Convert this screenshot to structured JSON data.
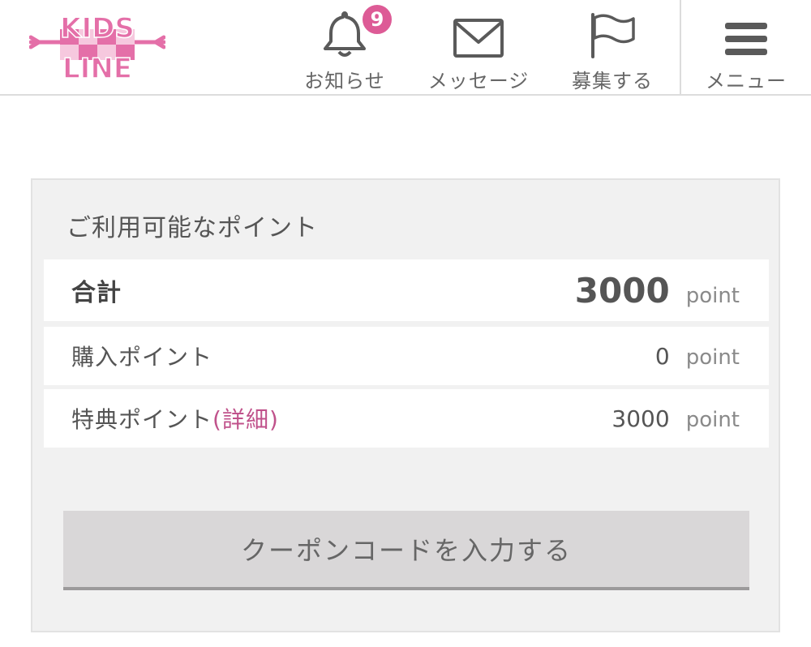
{
  "brand": {
    "logo_line1": "KIDS",
    "logo_line2": "LINE",
    "logo_color": "#e46fa8"
  },
  "nav": {
    "notice_label": "お知らせ",
    "notice_badge": "9",
    "notice_icon": "bell-icon",
    "message_label": "メッセージ",
    "message_icon": "envelope-icon",
    "recruit_label": "募集する",
    "recruit_icon": "flag-icon",
    "menu_label": "メニュー",
    "menu_icon": "hamburger-icon"
  },
  "points": {
    "title": "ご利用可能なポイント",
    "total_label": "合計",
    "total_value": "3000",
    "purchase_label": "購入ポイント",
    "purchase_value": "0",
    "bonus_label": "特典ポイント",
    "bonus_detail_link": "(詳細)",
    "bonus_value": "3000",
    "unit": "point"
  },
  "coupon": {
    "button_label": "クーポンコードを入力する"
  },
  "colors": {
    "accent": "#dd5b96",
    "link": "#c0528b",
    "card_bg": "#f1f1f1",
    "button_bg": "#d9d7d8"
  }
}
